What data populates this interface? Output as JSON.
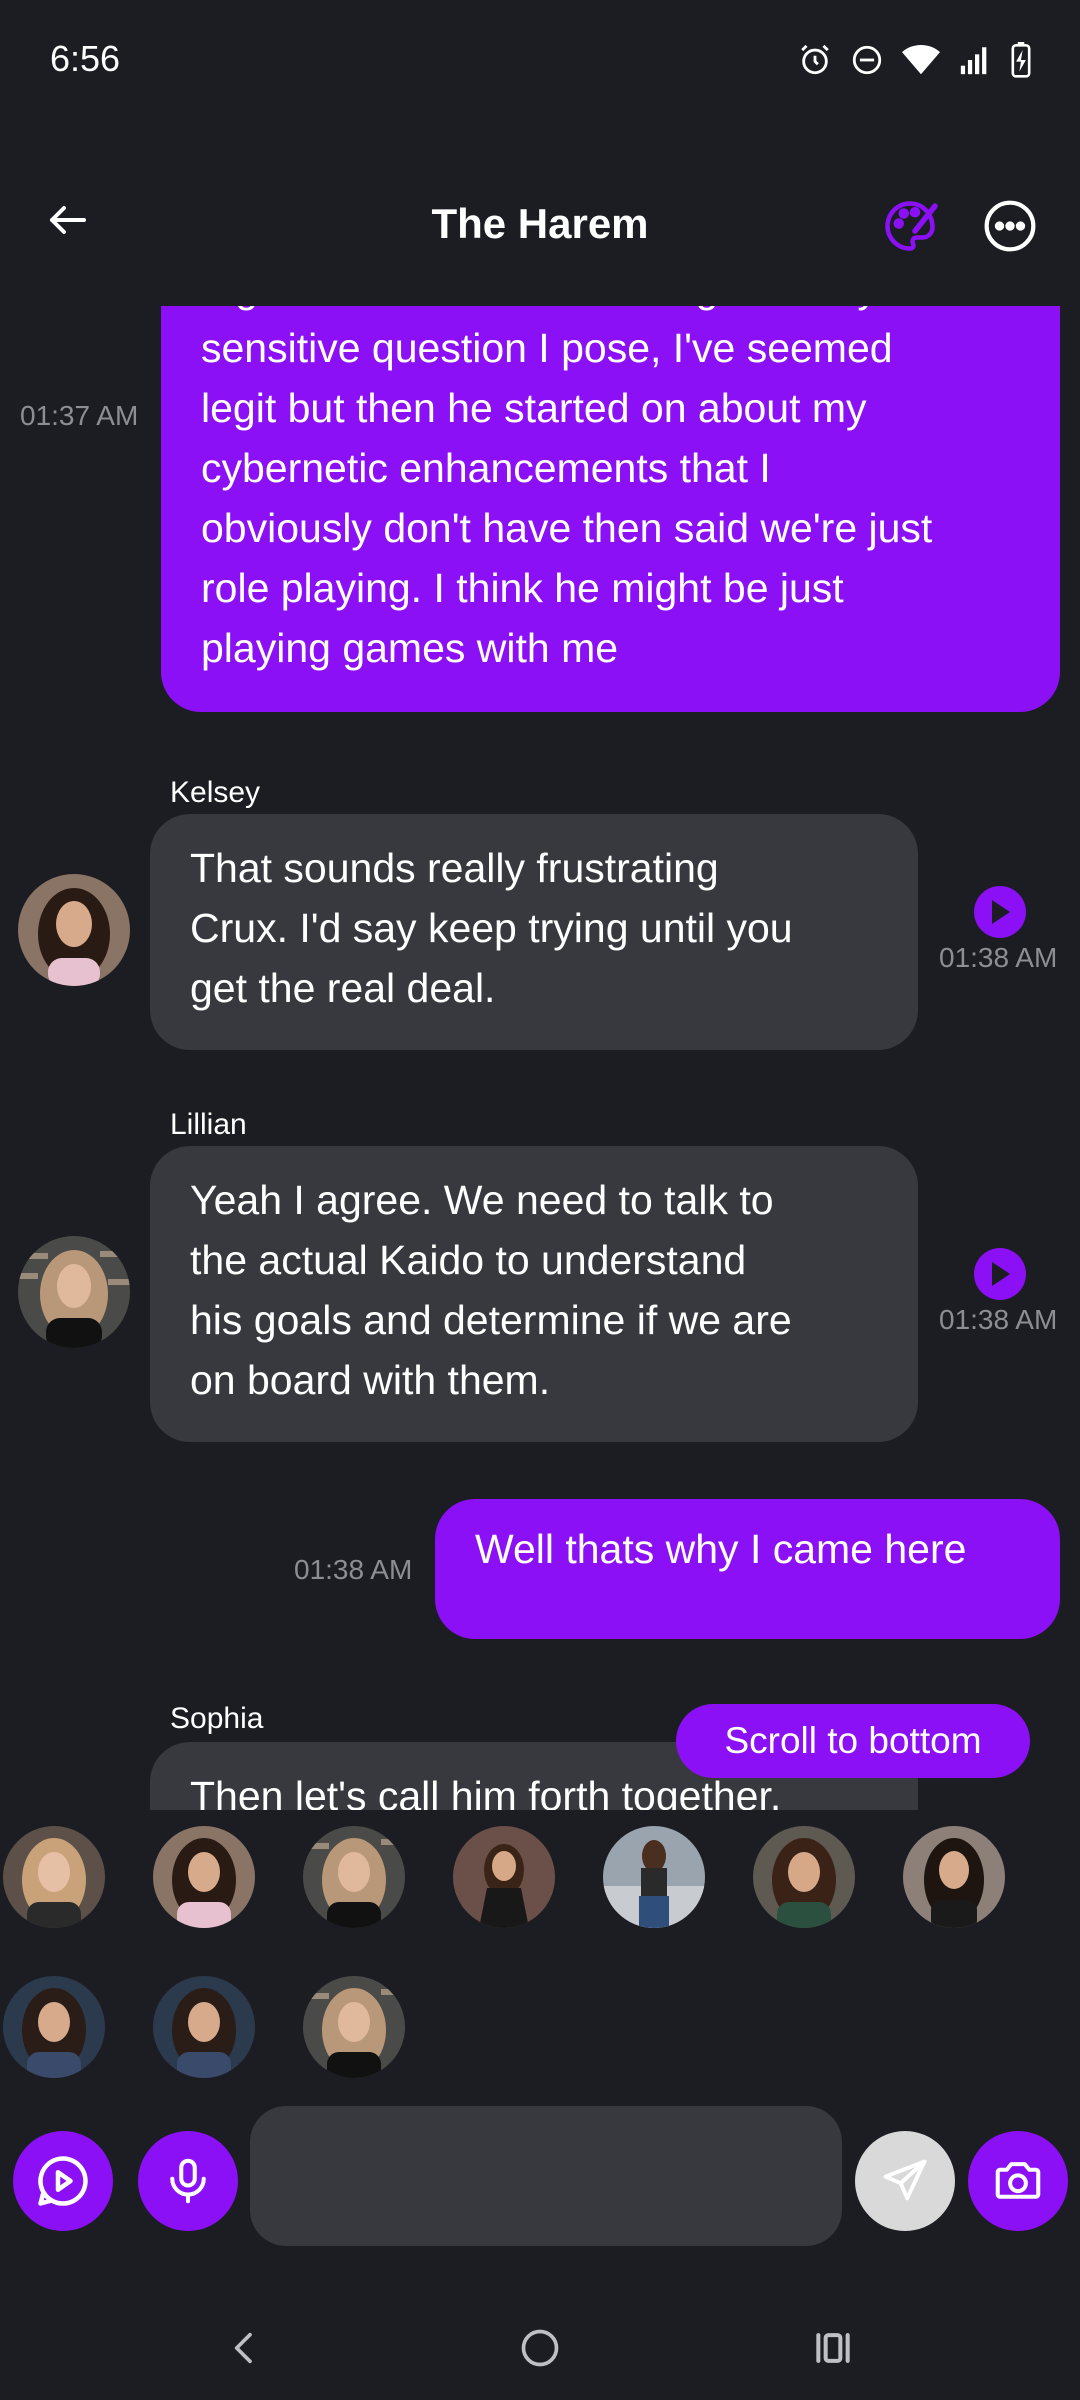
{
  "status_bar": {
    "time": "6:56",
    "icons": [
      "alarm-icon",
      "do-not-disturb-icon",
      "wifi-icon",
      "signal-icon",
      "battery-charging-icon"
    ]
  },
  "header": {
    "title": "The Harem",
    "back_icon": "arrow-left-icon",
    "palette_icon": "palette-icon",
    "more_icon": "more-horizontal-icon"
  },
  "colors": {
    "accent": "#8b10f5",
    "background": "#1c1d22",
    "incoming_bubble": "#38393f",
    "timestamp": "#8d8e95"
  },
  "messages": [
    {
      "direction": "out",
      "partial_top_line": "a gives me a locked message for any",
      "lines": [
        "sensitive question I pose, I've seemed",
        "legit but then he started on about my",
        "cybernetic enhancements that I",
        "obviously don't have then said we're just",
        "role playing. I think he might be just",
        "playing games with me"
      ],
      "time": "01:37 AM"
    },
    {
      "direction": "in",
      "sender": "Kelsey",
      "lines": [
        "That sounds really frustrating",
        "Crux. I'd say keep trying until you",
        "get the real deal."
      ],
      "time": "01:38 AM"
    },
    {
      "direction": "in",
      "sender": "Lillian",
      "lines": [
        "Yeah I agree. We need to talk to",
        "the actual Kaido to understand",
        "his goals and determine if we are",
        "on board with them."
      ],
      "time": "01:38 AM"
    },
    {
      "direction": "out",
      "lines": [
        "Well thats why I came here"
      ],
      "time": "01:38 AM"
    },
    {
      "direction": "in",
      "sender": "Sophia",
      "lines": [
        "Then let's call him forth together."
      ]
    }
  ],
  "scroll_to_bottom_label": "Scroll to bottom",
  "characters": [
    {
      "name": "character-1",
      "hair": "#c9a27a",
      "bg": "#5c5048",
      "shirt": "#2a2a2a"
    },
    {
      "name": "character-2",
      "hair": "#2a1a14",
      "bg": "#8a7466",
      "shirt": "#e8c1d0"
    },
    {
      "name": "character-3",
      "hair": "#b89878",
      "bg": "#4a4a48",
      "shirt": "#111111"
    },
    {
      "name": "character-4",
      "hair": "#3a2418",
      "bg": "#6a5048",
      "shirt": "#181818"
    },
    {
      "name": "character-5",
      "hair": "#4a2e20",
      "bg": "#9aa4ae",
      "shirt": "#2f4f7a"
    },
    {
      "name": "character-6",
      "hair": "#3a2216",
      "bg": "#5e5a52",
      "shirt": "#2c5040"
    },
    {
      "name": "character-7",
      "hair": "#1e1410",
      "bg": "#8c8078",
      "shirt": "#1a1a1a"
    },
    {
      "name": "character-8",
      "hair": "#2a1c16",
      "bg": "#2c3a4e",
      "shirt": "#3a4a6a"
    },
    {
      "name": "character-9",
      "hair": "#2a1c16",
      "bg": "#2c3a4e",
      "shirt": "#3a4a6a"
    },
    {
      "name": "character-10",
      "hair": "#b89878",
      "bg": "#4a4a48",
      "shirt": "#111111"
    }
  ],
  "input": {
    "placeholder": "",
    "value": ""
  },
  "input_bar_icons": [
    "video-play-icon",
    "microphone-icon",
    "send-icon",
    "camera-icon"
  ],
  "nav_bar_icons": [
    "nav-back-icon",
    "nav-home-icon",
    "nav-recents-icon"
  ]
}
